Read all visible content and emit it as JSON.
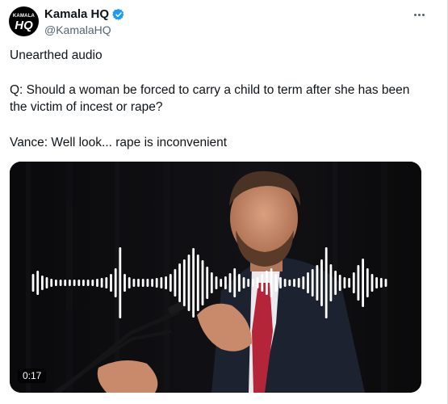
{
  "author": {
    "avatar_line1": "KAMALA",
    "avatar_line2": "HQ",
    "display_name": "Kamala HQ",
    "handle": "@KamalaHQ",
    "verified_icon": "verified-badge-icon",
    "verified_color": "#1d9bf0"
  },
  "tweet": {
    "line1": "Unearthed audio",
    "line2": "Q: Should a woman be forced to carry a child to term after she has been the victim of incest or rape?",
    "line3": "Vance: Well look... rape is inconvenient"
  },
  "media": {
    "duration": "0:17",
    "waveform": [
      22,
      30,
      18,
      14,
      10,
      8,
      8,
      8,
      8,
      8,
      8,
      8,
      8,
      8,
      10,
      12,
      14,
      22,
      36,
      88,
      22,
      14,
      10,
      10,
      10,
      10,
      10,
      12,
      14,
      16,
      22,
      34,
      48,
      58,
      70,
      86,
      70,
      56,
      40,
      26,
      16,
      10,
      16,
      24,
      36,
      22,
      14,
      10,
      10,
      14,
      22,
      30,
      36,
      22,
      14,
      10,
      8,
      10,
      12,
      16,
      26,
      34,
      44,
      58,
      88,
      46,
      30,
      20,
      14,
      12,
      26,
      44,
      60,
      36,
      22,
      14,
      12,
      10
    ]
  }
}
